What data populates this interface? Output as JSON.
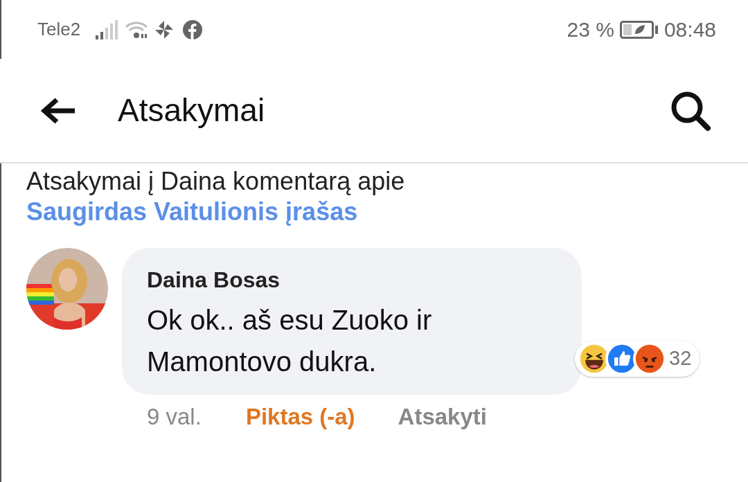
{
  "status_bar": {
    "carrier": "Tele2",
    "battery": "23 %",
    "time": "08:48"
  },
  "header": {
    "title": "Atsakymai"
  },
  "context": {
    "text": "Atsakymai į Daina komentarą apie",
    "link": "Saugirdas Vaitulionis įrašas"
  },
  "comments": [
    {
      "author": "Daina Bosas",
      "text": "Ok ok.. aš esu Zuoko ir Mamontovo dukra.",
      "reactions": [
        {
          "kind": "haha"
        },
        {
          "kind": "like"
        },
        {
          "kind": "angry"
        }
      ],
      "reaction_count": "32",
      "time": "9 val.",
      "my_reaction": "Piktas (-a)",
      "reply": "Atsakyti"
    }
  ]
}
